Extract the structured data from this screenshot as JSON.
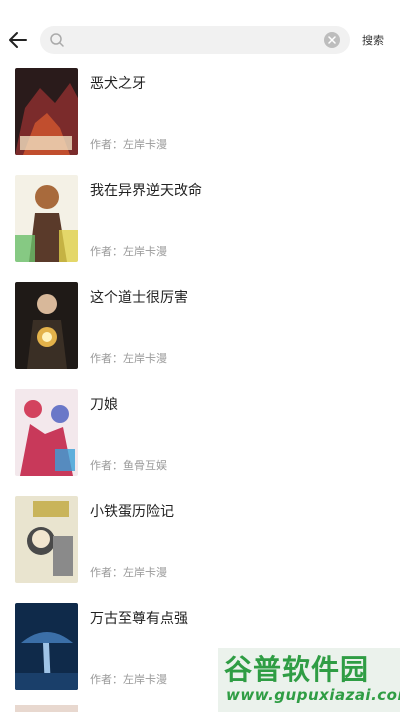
{
  "header": {
    "search": {
      "placeholder": "",
      "value": ""
    },
    "search_button_label": "搜索"
  },
  "books": [
    {
      "title": "恶犬之牙",
      "author": "作者：左岸卡漫",
      "cover_colors": [
        "#2a1b1b",
        "#7b2b2b",
        "#c14e2e"
      ]
    },
    {
      "title": "我在异界逆天改命",
      "author": "作者：左岸卡漫",
      "cover_colors": [
        "#f4f1e6",
        "#a86a3c",
        "#6abf6a"
      ]
    },
    {
      "title": "这个道士很厉害",
      "author": "作者：左岸卡漫",
      "cover_colors": [
        "#1f1a17",
        "#b07a3a",
        "#e3b24a"
      ]
    },
    {
      "title": "刀娘",
      "author": "作者：鱼骨互娱",
      "cover_colors": [
        "#f3e8ec",
        "#d3425e",
        "#6a78c8"
      ]
    },
    {
      "title": "小铁蛋历险记",
      "author": "作者：左岸卡漫",
      "cover_colors": [
        "#e9e4cf",
        "#4a4a4a",
        "#c9b45a"
      ]
    },
    {
      "title": "万古至尊有点强",
      "author": "作者：左岸卡漫",
      "cover_colors": [
        "#0f2a4a",
        "#3b6fa8",
        "#9fc3e6"
      ]
    }
  ],
  "watermark": {
    "text": "谷普软件园",
    "url": "www.gupuxiazai.com"
  }
}
